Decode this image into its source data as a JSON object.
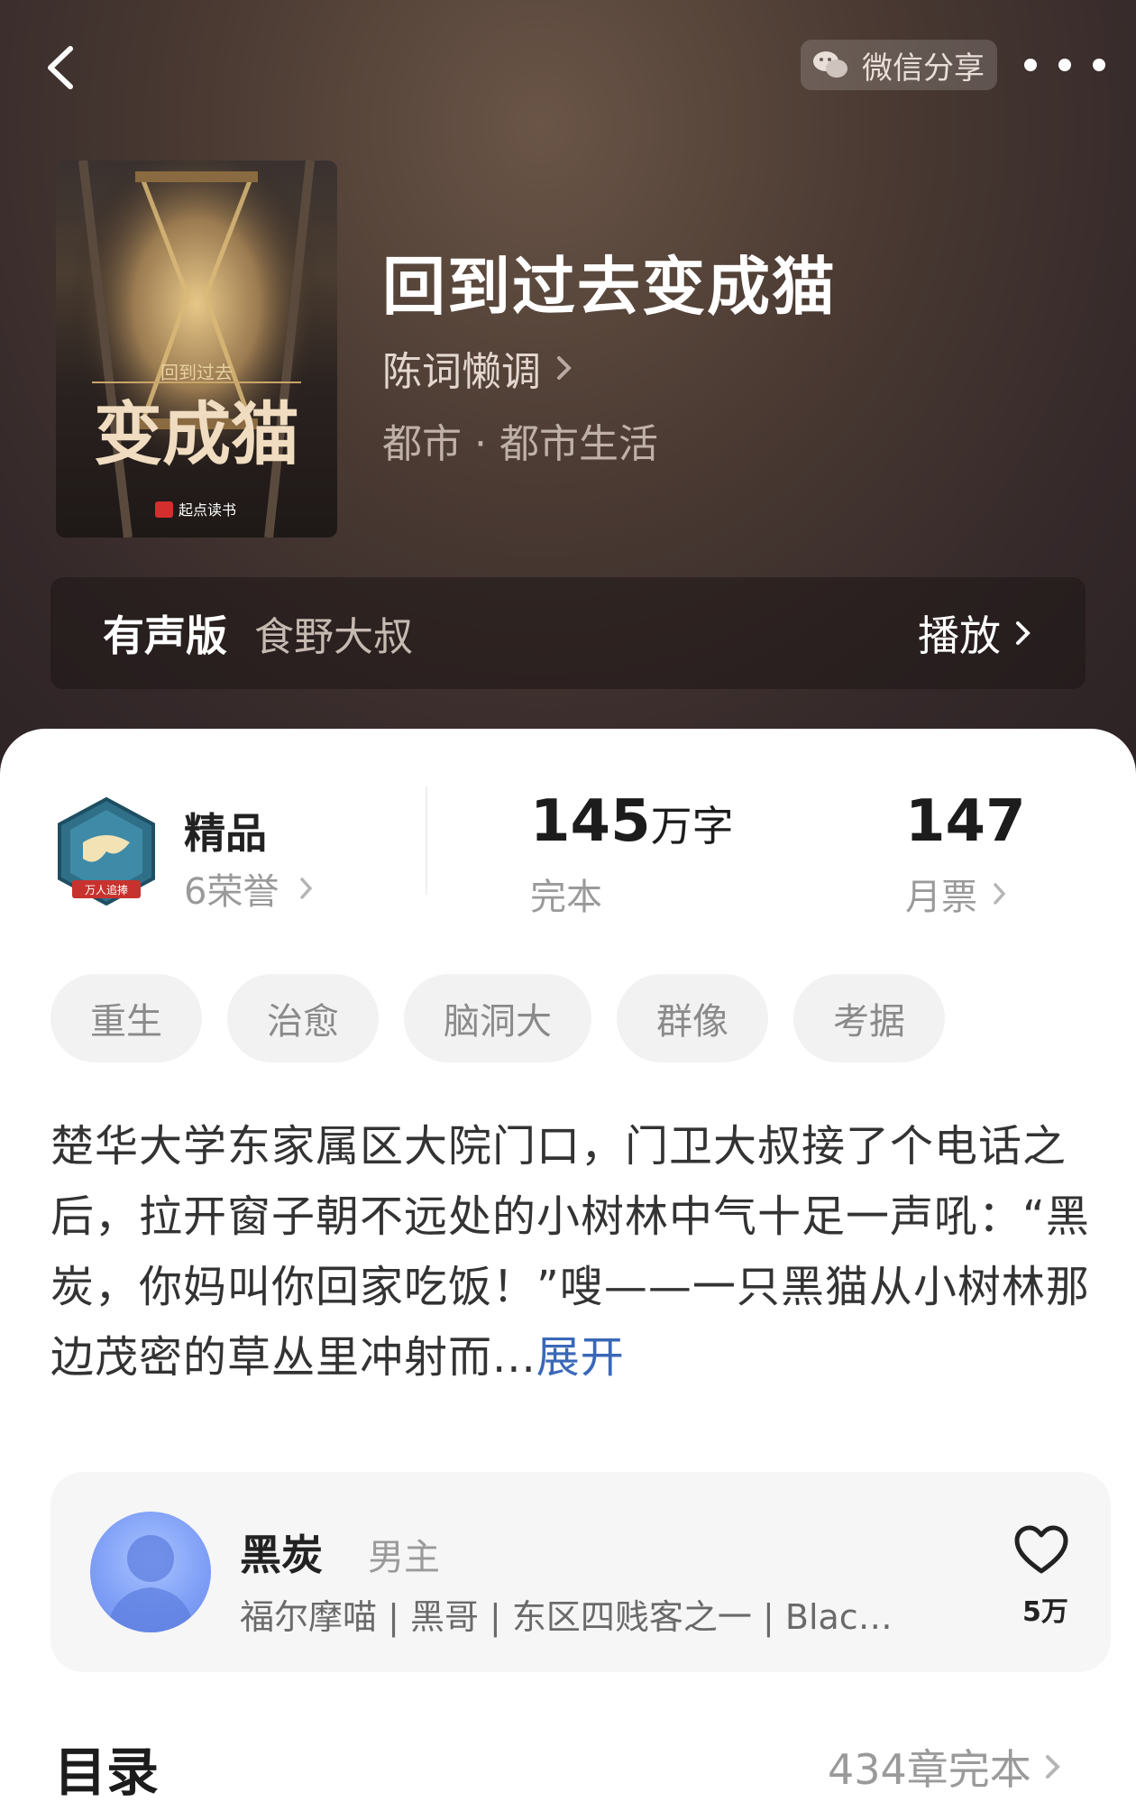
{
  "header": {
    "share_label": "微信分享",
    "back_icon": "back-arrow-icon",
    "more_icon": "more-dots-icon"
  },
  "book": {
    "title": "回到过去变成猫",
    "author": "陈词懒调",
    "genre": "都市 · 都市生活",
    "cover": {
      "small_title": "回到过去",
      "big_title": "变成猫",
      "publisher": "起点读书"
    }
  },
  "audio": {
    "label": "有声版",
    "reader": "食野大叔",
    "play_label": "播放"
  },
  "stats": {
    "honor_title": "精品",
    "honor_count": "6荣誉",
    "badge_ribbon": "万人追捧",
    "words_number": "145",
    "words_unit": "万字",
    "status": "完本",
    "tickets": "147",
    "tickets_label": "月票"
  },
  "tags": [
    "重生",
    "治愈",
    "脑洞大",
    "群像",
    "考据"
  ],
  "synopsis": {
    "text": "楚华大学东家属区大院门口，门卫大叔接了个电话之后，拉开窗子朝不远处的小树林中气十足一声吼：“黑炭，你妈叫你回家吃饭！”嗖——一只黑猫从小树林那边茂密的草丛里冲射而...",
    "expand": "展开"
  },
  "character": {
    "name": "黑炭",
    "role": "男主",
    "aliases": "福尔摩喵 | 黑哥 | 东区四贱客之一 | Blac…",
    "likes": "5万"
  },
  "toc": {
    "title": "目录",
    "meta": "434章完本"
  },
  "colors": {
    "accent_link": "#3a68b8",
    "hero_bg": "#3e3030"
  }
}
